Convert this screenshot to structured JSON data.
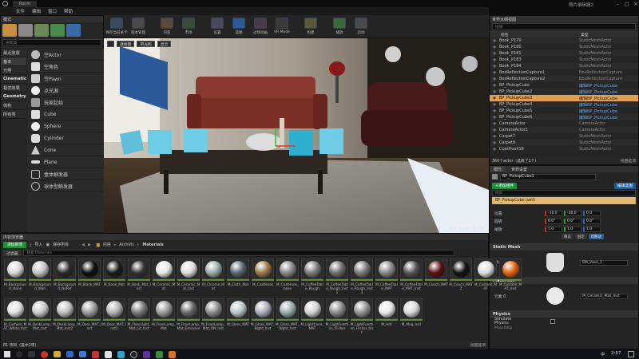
{
  "window": {
    "title": "Room",
    "right_title": "照片编辑器2"
  },
  "menu": [
    "文件",
    "编辑",
    "窗口",
    "帮助"
  ],
  "toolbar": [
    {
      "label": "保存当前关卡",
      "icon": "save-icon"
    },
    {
      "label": "版本管理",
      "icon": "source-control-icon"
    },
    {
      "label": "内容",
      "icon": "content-icon"
    },
    {
      "label": "市场",
      "icon": "marketplace-icon"
    },
    {
      "label": "设置",
      "icon": "settings-icon"
    },
    {
      "label": "蓝图",
      "icon": "blueprint-icon"
    },
    {
      "label": "过场动画",
      "icon": "cinematics-icon"
    },
    {
      "label": "VR Mode",
      "icon": "vr-icon"
    },
    {
      "label": "构建",
      "icon": "build-icon"
    },
    {
      "label": "播放",
      "icon": "play-icon"
    },
    {
      "label": "启动",
      "icon": "launch-icon"
    }
  ],
  "modes": {
    "title": "模式",
    "search_placeholder": "搜索类",
    "categories": [
      "最近放置",
      "基本",
      "光照",
      "Cinematic",
      "视觉效果",
      "Geometry",
      "体积",
      "所有类"
    ],
    "items": [
      "空Actor",
      "空角色",
      "空Pawn",
      "点光源",
      "玩家起始",
      "Cube",
      "Sphere",
      "Cylinder",
      "Cone",
      "Plane",
      "盒体触发器",
      "球体型触发器"
    ]
  },
  "viewport": {
    "buttons": [
      "透视图",
      "带光照",
      "显示"
    ],
    "footer": "关卡: Room (永久性)"
  },
  "outliner": {
    "title": "世界大纲视图",
    "search_placeholder": "搜索",
    "col_label": "标签",
    "col_type": "类型",
    "rows": [
      {
        "label": "Book_P179",
        "type": "StaticMeshActor"
      },
      {
        "label": "Book_P180",
        "type": "StaticMeshActor"
      },
      {
        "label": "Book_P181",
        "type": "StaticMeshActor"
      },
      {
        "label": "Book_P183",
        "type": "StaticMeshActor"
      },
      {
        "label": "Book_P184",
        "type": "StaticMeshActor"
      },
      {
        "label": "BoxReflectionCapture1",
        "type": "BoxReflectionCapture"
      },
      {
        "label": "BoxReflectionCapture2",
        "type": "BoxReflectionCapture"
      },
      {
        "label": "BP_PickupCube",
        "type": "编辑BP_PickupCube"
      },
      {
        "label": "BP_PickupCube2",
        "type": "编辑BP_PickupCube"
      },
      {
        "label": "BP_PickupCube3",
        "type": "编辑BP_PickupCube"
      },
      {
        "label": "BP_PickupCube4",
        "type": "编辑BP_PickupCube"
      },
      {
        "label": "BP_PickupCube5",
        "type": "编辑BP_PickupCube"
      },
      {
        "label": "BP_PickupCube6",
        "type": "编辑BP_PickupCube"
      },
      {
        "label": "CameraActor",
        "type": "CameraActor"
      },
      {
        "label": "CameraActor1",
        "type": "CameraActor"
      },
      {
        "label": "Carpet7",
        "type": "StaticMeshActor"
      },
      {
        "label": "Carpet9",
        "type": "StaticMeshActor"
      },
      {
        "label": "CoatHook18",
        "type": "StaticMeshActor"
      }
    ],
    "selected_index": 9,
    "footer": "360个actor（选择了1个）",
    "view_options": "视图选项"
  },
  "details": {
    "title": "细节",
    "title2": "世界设置",
    "actor_name": "BP_PickupCube3",
    "add_component": "+添加组件",
    "edit_blueprint": "编辑蓝图",
    "search_placeholder": "搜索",
    "component": "BP_PickupCube (self)",
    "transform": {
      "location": [
        "-10.0",
        "-30.0",
        "0.0"
      ],
      "rotation": [
        "0.0°",
        "0.0°",
        "0.0°"
      ],
      "scale": [
        "1.0",
        "1.0",
        "1.0"
      ],
      "labels": [
        "位置",
        "旋转",
        "缩放"
      ],
      "mobility": [
        "静态",
        "固定",
        "可移动"
      ]
    },
    "static_mesh_section": "Static Mesh",
    "static_mesh_label": "Static Mesh",
    "static_mesh_value": "SM_Vase_1",
    "materials_section": "Materials",
    "element_label": "元素 0",
    "element_value": "M_Ceramic_Mat_Inst",
    "physics_section": "Physics",
    "simulate_label": "Simulate Physics",
    "mass_label": "MassInKg"
  },
  "content_browser": {
    "title": "内容浏览器",
    "add_new": "添加新项",
    "import": "导入",
    "save_all": "保存所有",
    "path": [
      "内容",
      "ArchVis",
      "Materials"
    ],
    "filter": "过滤器",
    "search_placeholder": "搜索 Materials",
    "status": "81 项目（选中1项）",
    "view_options": "视图选项",
    "materials": [
      {
        "name": "M_Background_stone",
        "color": "#d8d8d8"
      },
      {
        "name": "M_Background_Wall",
        "color": "#c4c4c4"
      },
      {
        "name": "M_Background_NoRef",
        "color": "#2a2a2a"
      },
      {
        "name": "M_Black_MAT",
        "color": "#0d0d0d"
      },
      {
        "name": "M_Book_Mat",
        "color": "#1a1a1a"
      },
      {
        "name": "M_Book_Mat_Inst",
        "color": "#333"
      },
      {
        "name": "M_Ceramic_Mat",
        "color": "#e8e8e8"
      },
      {
        "name": "M_Ceramic_Mat_Inst",
        "color": "#dedede"
      },
      {
        "name": "M_Chrome_Mat",
        "color": "#9aa"
      },
      {
        "name": "M_Cloth_Mat",
        "color": "#5a6670"
      },
      {
        "name": "M_CoatHook",
        "color": "#9c7a4a"
      },
      {
        "name": "M_CoatHook_base",
        "color": "#888"
      },
      {
        "name": "M_CoffeeTable_Rough",
        "color": "#7a7a7a"
      },
      {
        "name": "M_CoffeeTable_Rough_Inst1",
        "color": "#6e6e6e"
      },
      {
        "name": "M_CoffeeTable_Rough_Inst3",
        "color": "#777"
      },
      {
        "name": "M_CoffeeTable_MAT",
        "color": "#8a8a8a"
      },
      {
        "name": "M_CoffeeTable_MAT_Inst",
        "color": "#555"
      },
      {
        "name": "M_Couch_MAT",
        "color": "#5a1010"
      },
      {
        "name": "M_Couch_MAT2",
        "color": "#111"
      },
      {
        "name": "M_Cushion_MAT",
        "color": "#ddd"
      },
      {
        "name": "M_Cushion_MAT_Inst",
        "color": "#e06010"
      }
    ],
    "materials_row2": [
      {
        "name": "M_Cushion_MAT_White_Inst",
        "color": "#e0e0e0"
      },
      {
        "name": "M_DeskLamp_Mat_Inst",
        "color": "#c8c8c8"
      },
      {
        "name": "M_DeskLamp_Mat_Inst2",
        "color": "#c0c0c0"
      },
      {
        "name": "M_Door_MAT_Inst",
        "color": "#9a9a9a"
      },
      {
        "name": "M_Door_MAT_Inst2",
        "color": "#b0b0b0"
      },
      {
        "name": "M_FloorLight_Mat_Lit_Inst",
        "color": "#777"
      },
      {
        "name": "M_FloorLamp_Mat",
        "color": "#999"
      },
      {
        "name": "M_FloorLamp_Mat_Emissive",
        "color": "#666"
      },
      {
        "name": "M_FloorLamp_Mat_ON_Inst",
        "color": "#8a8a8a"
      },
      {
        "name": "M_Glass_MAT",
        "color": "#b8c4c8"
      },
      {
        "name": "M_Glass_MAT_Night_Inst",
        "color": "#aab"
      },
      {
        "name": "M_Glass_MAT_Night_Inst",
        "color": "#9aa"
      },
      {
        "name": "M_LightCone_MAT",
        "color": "#cfcfcf"
      },
      {
        "name": "M_LightFunction_Flicker",
        "color": "#888"
      },
      {
        "name": "M_LightFunction_Flicker_Inst",
        "color": "#909090"
      },
      {
        "name": "M_Hdr",
        "color": "#e8e8e8"
      },
      {
        "name": "M_Mug_Inst",
        "color": "#d8d8d8"
      }
    ]
  },
  "taskbar": {
    "time": "2:57",
    "lang": "中"
  },
  "colors": {
    "accent": "#2a7ec8",
    "selected": "#e0a050",
    "green": "#1f8f3a",
    "blue_btn": "#1e5a9e"
  }
}
